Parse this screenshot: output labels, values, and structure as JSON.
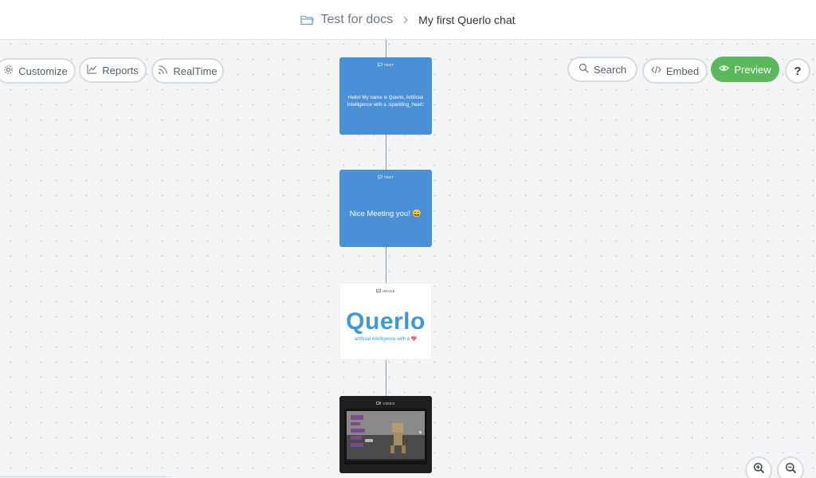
{
  "breadcrumb": {
    "project": "Test for docs",
    "chat": "My first Querlo chat"
  },
  "toolbar_left": {
    "customize_label": "Customize",
    "reports_label": "Reports",
    "realtime_label": "RealTime"
  },
  "toolbar_right": {
    "search_label": "Search",
    "embed_label": "Embed",
    "preview_label": "Preview",
    "help_label": "?"
  },
  "nodes": [
    {
      "type_label": "TEXT",
      "text": "Hello! My name is Querlo, Artificial Intelligence with a :sparkling_heart:"
    },
    {
      "type_label": "TEXT",
      "text": "Nice Meeting you! 😀"
    },
    {
      "type_label": "IMAGE",
      "logo_text": "Querlo",
      "logo_tagline": "artificial intelligence with a 💖"
    },
    {
      "type_label": "VIDEO"
    }
  ],
  "colors": {
    "text_node": "#4a90d9",
    "preview_button": "#5cb85c",
    "querlo_brand": "#3f98d4"
  },
  "icons": {
    "breadcrumb": "folder-icon",
    "customize": "gear-icon",
    "reports": "chart-icon",
    "realtime": "rss-icon",
    "search": "search-icon",
    "embed": "code-icon",
    "preview": "eye-icon",
    "zoom_in": "zoom-in-icon",
    "zoom_out": "zoom-out-icon"
  }
}
